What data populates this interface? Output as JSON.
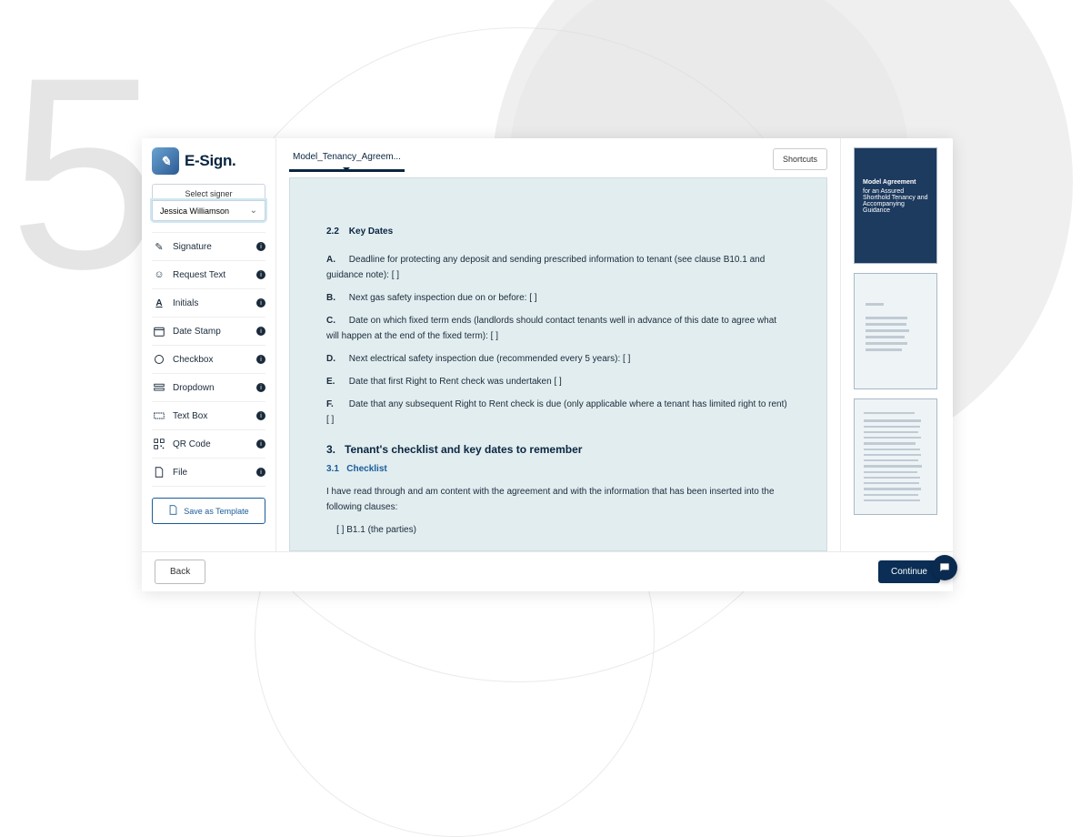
{
  "bg_number": "5",
  "logo_text": "E-Sign.",
  "sidebar": {
    "select_signer_label": "Select signer",
    "selected_signer": "Jessica Williamson",
    "tools": [
      {
        "id": "signature",
        "label": "Signature"
      },
      {
        "id": "request-text",
        "label": "Request Text"
      },
      {
        "id": "initials",
        "label": "Initials"
      },
      {
        "id": "date-stamp",
        "label": "Date Stamp"
      },
      {
        "id": "checkbox",
        "label": "Checkbox"
      },
      {
        "id": "dropdown",
        "label": "Dropdown"
      },
      {
        "id": "text-box",
        "label": "Text Box"
      },
      {
        "id": "qr-code",
        "label": "QR Code"
      },
      {
        "id": "file",
        "label": "File"
      }
    ],
    "save_as_template": "Save as Template"
  },
  "header": {
    "tab_label": "Model_Tenancy_Agreem...",
    "shortcuts_label": "Shortcuts"
  },
  "document": {
    "sec22_num": "2.2",
    "sec22_title": "Key Dates",
    "items": {
      "A": "Deadline for protecting any deposit and sending prescribed information to tenant (see clause B10.1 and guidance note):  [                                  ]",
      "B": "Next gas safety inspection due on or before:   [                                  ]",
      "C": "Date on which fixed term ends (landlords should contact tenants well in advance of this date to agree what will happen at the end of the fixed term):   [                                  ]",
      "D": "Next electrical safety inspection due (recommended every 5 years):   [                                  ]",
      "E": "Date that first Right to Rent check was undertaken [                                  ]",
      "F": "Date that any subsequent Right to Rent check is due (only applicable where a tenant has limited right to rent)   [                                  ]"
    },
    "sec3_num": "3.",
    "sec3_title": "Tenant's checklist and key dates to remember",
    "sec31_num": "3.1",
    "sec31_title": "Checklist",
    "checklist_intro": "I have read through and am content with the agreement and with the information that has been inserted into the following clauses:",
    "checklist_line1": "[          ] B1.1 (the parties)"
  },
  "thumbs": {
    "cover_title": "Model Agreement",
    "cover_sub": "for an Assured Shorthold Tenancy and Accompanying Guidance"
  },
  "footer": {
    "back": "Back",
    "continue": "Continue"
  }
}
